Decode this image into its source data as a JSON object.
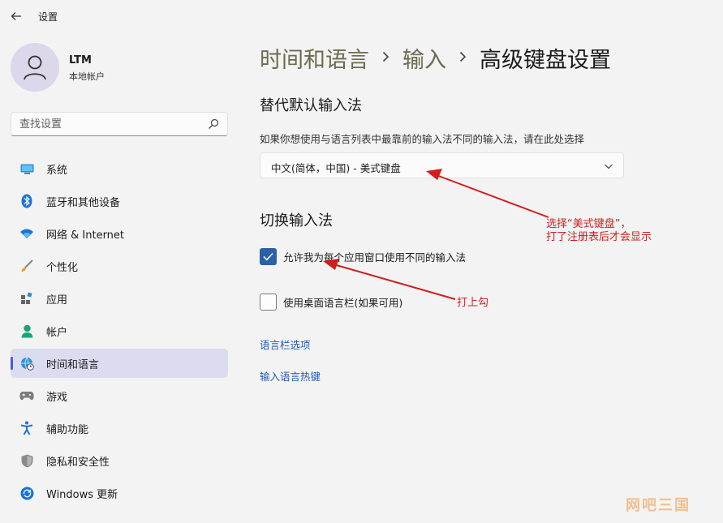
{
  "window": {
    "title": "设置"
  },
  "user": {
    "name": "LTM",
    "account_type": "本地帐户"
  },
  "search": {
    "placeholder": "查找设置"
  },
  "sidebar": {
    "items": [
      {
        "label": "系统",
        "icon": "system-icon",
        "active": false
      },
      {
        "label": "蓝牙和其他设备",
        "icon": "bluetooth-icon",
        "active": false
      },
      {
        "label": "网络 & Internet",
        "icon": "wifi-icon",
        "active": false
      },
      {
        "label": "个性化",
        "icon": "brush-icon",
        "active": false
      },
      {
        "label": "应用",
        "icon": "apps-icon",
        "active": false
      },
      {
        "label": "帐户",
        "icon": "account-icon",
        "active": false
      },
      {
        "label": "时间和语言",
        "icon": "globe-clock-icon",
        "active": true
      },
      {
        "label": "游戏",
        "icon": "gamepad-icon",
        "active": false
      },
      {
        "label": "辅助功能",
        "icon": "accessibility-icon",
        "active": false
      },
      {
        "label": "隐私和安全性",
        "icon": "shield-icon",
        "active": false
      },
      {
        "label": "Windows 更新",
        "icon": "update-icon",
        "active": false
      }
    ]
  },
  "breadcrumb": {
    "level1": "时间和语言",
    "level2": "输入",
    "current": "高级键盘设置"
  },
  "override_section": {
    "title": "替代默认输入法",
    "description": "如果你想使用与语言列表中最靠前的输入法不同的输入法，请在此处选择",
    "selected_value": "中文(简体，中国) - 美式键盘"
  },
  "switch_section": {
    "title": "切换输入法",
    "per_app_label": "允许我为每个应用窗口使用不同的输入法",
    "per_app_checked": true,
    "desktop_bar_label": "使用桌面语言栏(如果可用)",
    "desktop_bar_checked": false
  },
  "links": {
    "language_bar_options": "语言栏选项",
    "input_hotkeys": "输入语言热键"
  },
  "annotations": {
    "note1_line1": "选择“美式键盘”，",
    "note1_line2": "打了注册表后才会显示",
    "note2": "打上勾"
  },
  "watermark": "网吧三国",
  "colors": {
    "accent": "#2b5fa6",
    "active_nav": "#dcdcf0",
    "link": "#1f5db5",
    "annotation": "#d21e1e"
  }
}
